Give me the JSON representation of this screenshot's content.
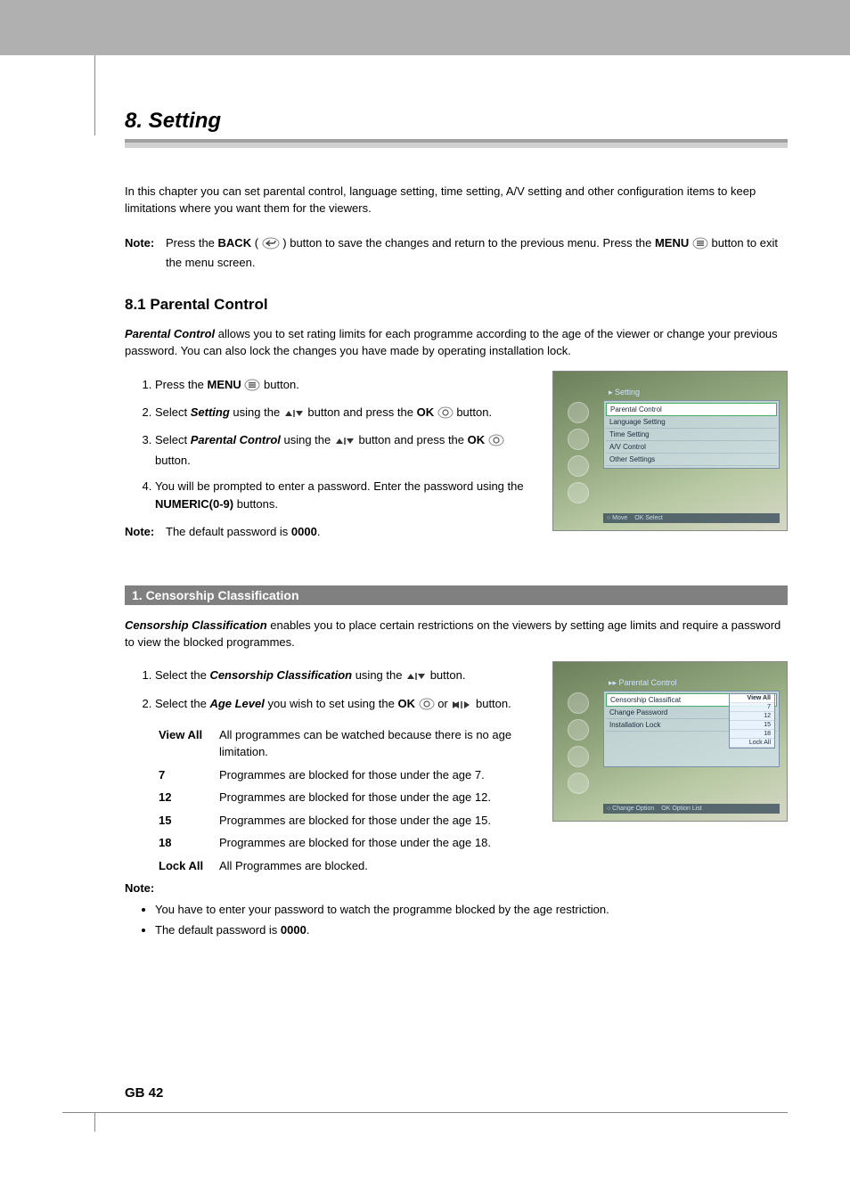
{
  "chapter_title": "8. Setting",
  "intro": "In this chapter you can set parental control, language setting, time setting, A/V setting and other configuration items to keep limitations where you want them for the viewers.",
  "top_note": {
    "label": "Note:",
    "pre": "Press the ",
    "back_bold": "BACK",
    "mid1": " ( ",
    "mid2": " ) button to save the changes and return to the previous menu. Press the ",
    "menu_bold": "MENU",
    "post": " button to exit the menu screen."
  },
  "section81": {
    "title": "8.1 Parental Control",
    "lead_bold": "Parental Control",
    "lead_rest": " allows you to set rating limits for each programme according to the age of the viewer or change your previous password. You can also lock the changes you have made by operating installation lock.",
    "steps": [
      {
        "pre": "Press the ",
        "b1": "MENU",
        "mid": " ",
        "post": " button."
      },
      {
        "pre": "Select ",
        "bi": "Setting",
        "mid1": " using the ",
        "mid2": " button and press the ",
        "b1": "OK",
        "post": " button."
      },
      {
        "pre": "Select ",
        "bi": "Parental Control",
        "mid1": " using the ",
        "mid2": " button and press the ",
        "b1": "OK",
        "post": " button."
      },
      {
        "pre": "You will be prompted to enter a password. Enter the password using the ",
        "b1": "NUMERIC(0-9)",
        "post": " buttons."
      }
    ],
    "note_label": "Note:",
    "note_text_pre": "The default password is ",
    "note_text_bold": "0000",
    "note_text_post": "."
  },
  "subbar": "1. Censorship Classification",
  "cc": {
    "lead_bold": "Censorship Classification",
    "lead_rest": " enables you to place certain restrictions on the viewers by setting age limits and require a password to view the blocked programmes.",
    "step1": {
      "pre": "Select the ",
      "bi": "Censorship Classification",
      "mid": " using the ",
      "post": " button."
    },
    "step2": {
      "pre": "Select the ",
      "bi": "Age Level",
      "mid1": " you wish to set using the ",
      "b1": "OK",
      "mid2": " or ",
      "post": " button."
    },
    "levels": [
      {
        "k": "View All",
        "v": "All programmes can be watched because there is no age limitation."
      },
      {
        "k": "7",
        "v": "Programmes are blocked for those under the age 7."
      },
      {
        "k": "12",
        "v": "Programmes are blocked for those under the age 12."
      },
      {
        "k": "15",
        "v": "Programmes are blocked for those under the age 15."
      },
      {
        "k": "18",
        "v": "Programmes are blocked for those under the age 18."
      },
      {
        "k": "Lock All",
        "v": "All Programmes are blocked."
      }
    ],
    "note_label": "Note:",
    "note_bullet1": "You have to enter your password to watch the programme blocked by the age restriction.",
    "note_bullet2_pre": "The default password is ",
    "note_bullet2_bold": "0000",
    "note_bullet2_post": "."
  },
  "tv1": {
    "header": "▸ Setting",
    "items": [
      "Parental Control",
      "Language Setting",
      "Time Setting",
      "A/V Control",
      "Other Settings"
    ],
    "foot1": "○ Move",
    "foot2": "OK Select"
  },
  "tv2": {
    "header": "▸▸ Parental Control",
    "items": [
      "Censorship Classificat",
      "Change Password",
      "Installation Lock"
    ],
    "opts": [
      "View All",
      "7",
      "12",
      "15",
      "18",
      "Lock All"
    ],
    "foot1": "○ Change Option",
    "foot2": "OK Option List"
  },
  "footer": "GB 42"
}
